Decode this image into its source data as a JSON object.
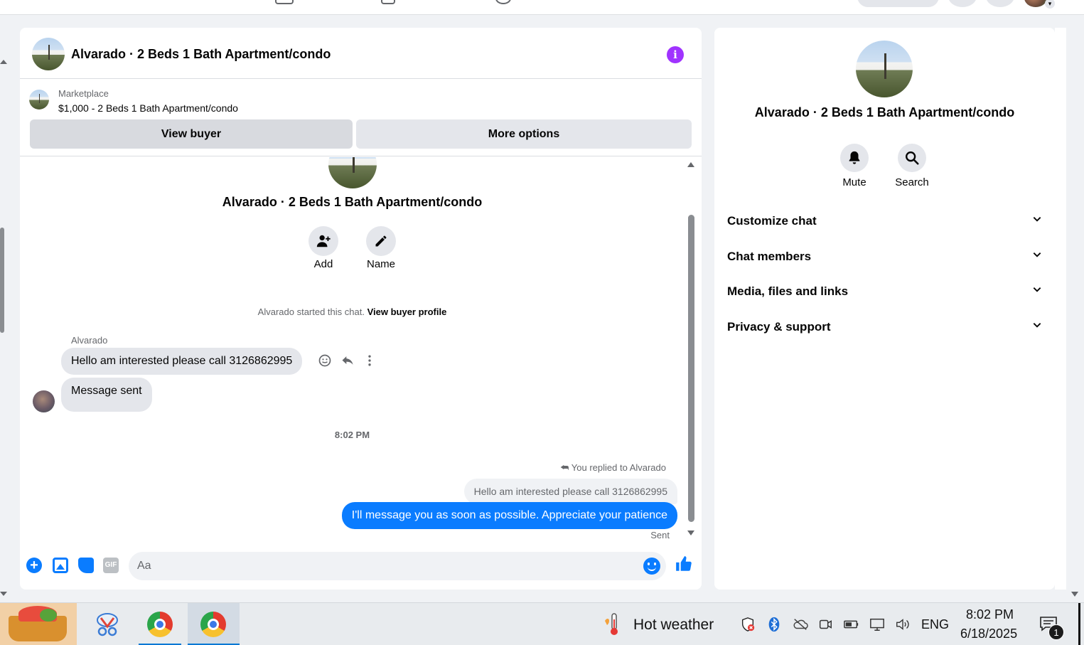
{
  "chat": {
    "title": "Alvarado · 2 Beds 1 Bath Apartment/condo",
    "marketplace_label": "Marketplace",
    "marketplace_listing": "$1,000 - 2 Beds 1 Bath Apartment/condo",
    "view_buyer_label": "View buyer",
    "more_options_label": "More options",
    "add_label": "Add",
    "name_label": "Name",
    "started_text": "Alvarado started this chat.",
    "view_buyer_profile_label": "View buyer profile",
    "sender_name": "Alvarado",
    "messages_in": [
      "Hello am interested please call 3126862995",
      "Message sent"
    ],
    "timestamp": "8:02 PM",
    "replied_text": "You replied to Alvarado",
    "quoted_text": "Hello am interested please call 3126862995",
    "message_out": "I'll message you as soon as possible. Appreciate your patience",
    "status": "Sent",
    "composer_placeholder": "Aa",
    "gif_label": "GIF",
    "accent_color": "#0a7cff"
  },
  "side": {
    "title": "Alvarado · 2 Beds 1 Bath Apartment/condo",
    "mute_label": "Mute",
    "search_label": "Search",
    "sections": [
      "Customize chat",
      "Chat members",
      "Media, files and links",
      "Privacy & support"
    ]
  },
  "taskbar": {
    "weather": "Hot weather",
    "language": "ENG",
    "time": "8:02 PM",
    "date": "6/18/2025",
    "notification_count": "1"
  }
}
